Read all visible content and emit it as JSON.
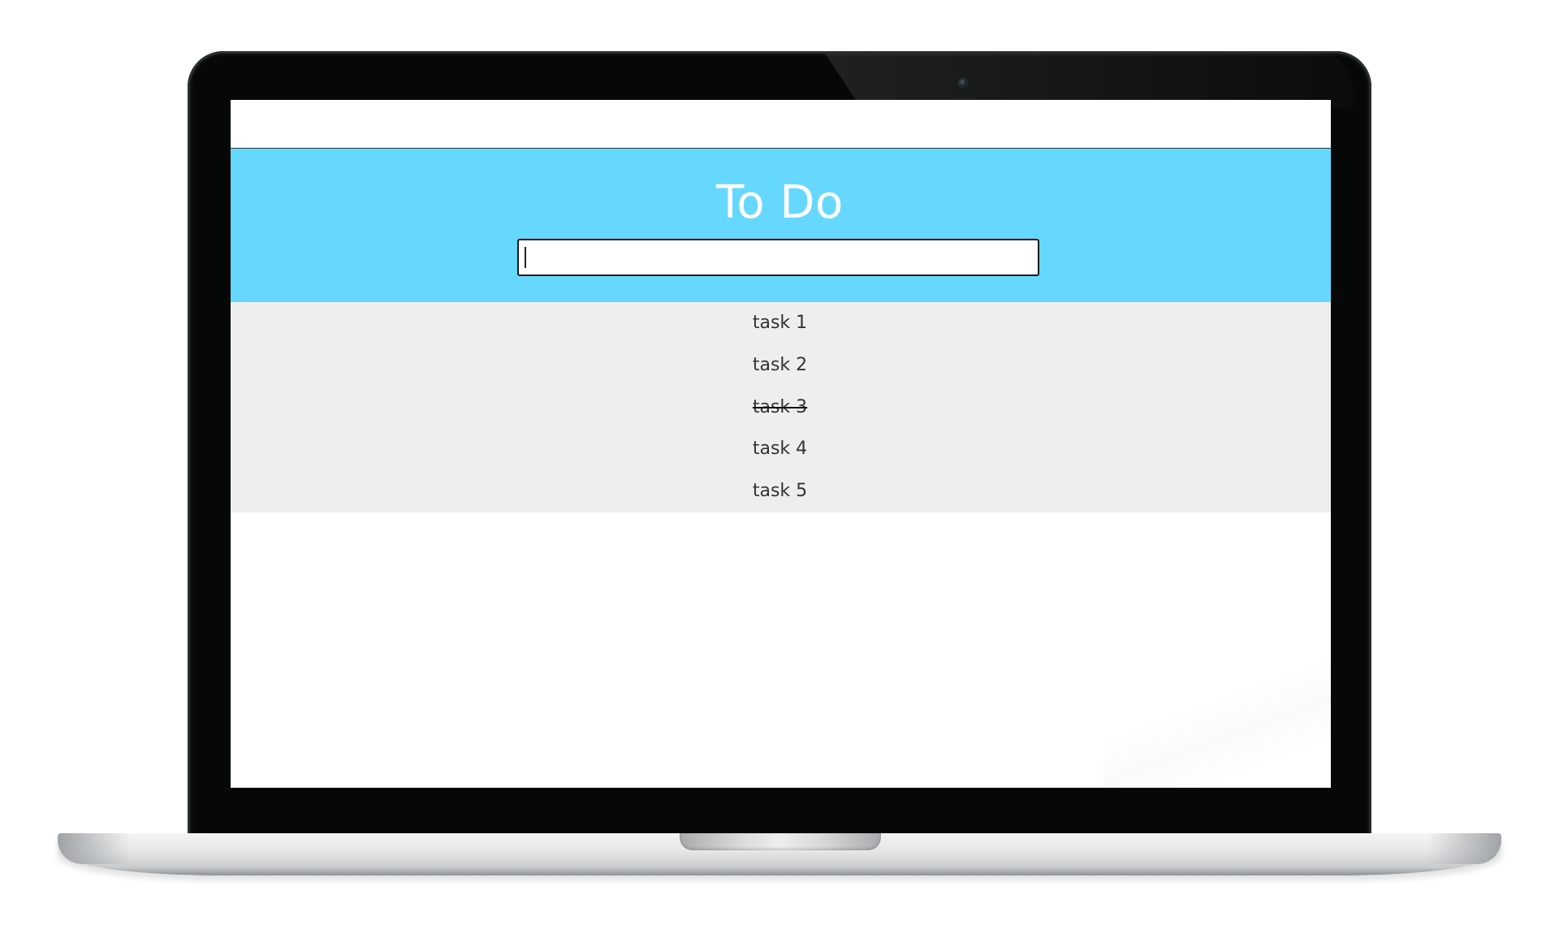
{
  "app": {
    "title": "To Do"
  },
  "input": {
    "value": "",
    "placeholder": ""
  },
  "tasks": [
    {
      "label": "task 1",
      "done": false
    },
    {
      "label": "task 2",
      "done": false
    },
    {
      "label": "task 3",
      "done": true
    },
    {
      "label": "task 4",
      "done": false
    },
    {
      "label": "task 5",
      "done": false
    }
  ],
  "colors": {
    "header": "#66d8fd",
    "list_background": "#eeeeee",
    "title_text": "#ffffff",
    "task_text": "#333333"
  }
}
